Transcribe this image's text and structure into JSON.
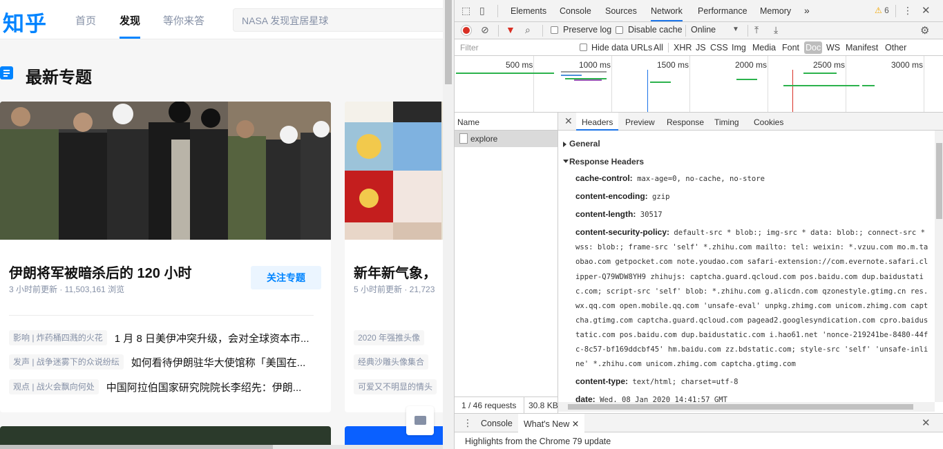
{
  "site": {
    "logo": "知乎",
    "nav": [
      "首页",
      "发现",
      "等你来答"
    ],
    "search_placeholder": "NASA 发现宜居星球",
    "section_title": "最新专题",
    "card1": {
      "title": "伊朗将军被暗杀后的 120 小时",
      "meta": "3 小时前更新 · 11,503,161 浏览",
      "follow_label": "关注专题",
      "articles": [
        {
          "tag": "影响 | 炸药桶四溅的火花",
          "title": "1 月 8 日美伊冲突升级，会对全球资本市..."
        },
        {
          "tag": "发声 | 战争迷雾下的众说纷纭",
          "title": "如何看待伊朗驻华大使馆称「美国在..."
        },
        {
          "tag": "观点 | 战火会飘向何处",
          "title": "中国阿拉伯国家研究院院长李绍先：伊朗..."
        }
      ]
    },
    "card2": {
      "title": "新年新气象，",
      "meta": "5 小时前更新 · 21,723",
      "tags": [
        "2020 年强推头像",
        "经典沙雕头像集合",
        "可爱又不明显的情头"
      ]
    }
  },
  "devtools": {
    "tabs": [
      "Elements",
      "Console",
      "Sources",
      "Network",
      "Performance",
      "Memory"
    ],
    "more": "»",
    "warnings": "6",
    "toolbar": {
      "preserve_log": "Preserve log",
      "disable_cache": "Disable cache",
      "throttle": "Online"
    },
    "filter_placeholder": "Filter",
    "hide_data_urls": "Hide data URLs",
    "types": [
      "All",
      "XHR",
      "JS",
      "CSS",
      "Img",
      "Media",
      "Font",
      "Doc",
      "WS",
      "Manifest",
      "Other"
    ],
    "timeline_labels": [
      "500 ms",
      "1000 ms",
      "1500 ms",
      "2000 ms",
      "2500 ms",
      "3000 ms"
    ],
    "name_header": "Name",
    "request_name": "explore",
    "summary_requests": "1 / 46 requests",
    "summary_size": "30.8 KB",
    "detail_tabs": [
      "Headers",
      "Preview",
      "Response",
      "Timing",
      "Cookies"
    ],
    "general": "General",
    "response_headers": "Response Headers",
    "headers": [
      {
        "k": "cache-control:",
        "v": "max-age=0, no-cache, no-store"
      },
      {
        "k": "content-encoding:",
        "v": "gzip"
      },
      {
        "k": "content-length:",
        "v": "30517"
      },
      {
        "k": "content-security-policy:",
        "v": "default-src * blob:; img-src * data: blob:; connect-src * wss: blob:; frame-src 'self' *.zhihu.com mailto: tel: weixin: *.vzuu.com mo.m.taobao.com getpocket.com note.youdao.com safari-extension://com.evernote.safari.clipper-Q79WDW8YH9 zhihujs: captcha.guard.qcloud.com pos.baidu.com dup.baidustatic.com; script-src 'self' blob: *.zhihu.com g.alicdn.com qzonestyle.gtimg.cn res.wx.qq.com open.mobile.qq.com 'unsafe-eval' unpkg.zhimg.com unicom.zhimg.com captcha.gtimg.com captcha.guard.qcloud.com pagead2.googlesyndication.com cpro.baidustatic.com pos.baidu.com dup.baidustatic.com i.hao61.net 'nonce-219241be-8480-44fc-8c57-bf169ddcbf45' hm.baidu.com zz.bdstatic.com; style-src 'self' 'unsafe-inline' *.zhihu.com unicom.zhimg.com captcha.gtimg.com"
      },
      {
        "k": "content-type:",
        "v": "text/html; charset=utf-8"
      },
      {
        "k": "date:",
        "v": "Wed, 08 Jan 2020 14:41:57 GMT"
      }
    ],
    "drawer_tabs": [
      "Console",
      "What's New"
    ],
    "drawer_text": "Highlights from the Chrome 79 update"
  }
}
